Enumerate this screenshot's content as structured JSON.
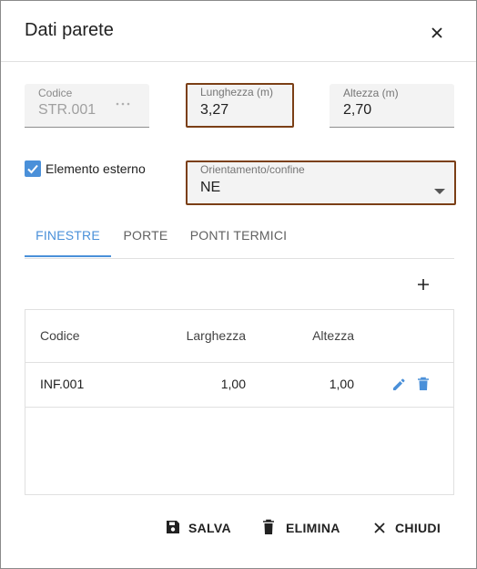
{
  "dialog": {
    "title": "Dati parete"
  },
  "fields": {
    "codice": {
      "label": "Codice",
      "value": "STR.001"
    },
    "lunghezza": {
      "label": "Lunghezza (m)",
      "value": "3,27"
    },
    "altezza": {
      "label": "Altezza (m)",
      "value": "2,70"
    },
    "elemento_esterno": {
      "label": "Elemento esterno",
      "checked": true
    },
    "orientamento": {
      "label": "Orientamento/confine",
      "value": "NE"
    }
  },
  "tabs": [
    {
      "label": "FINESTRE",
      "active": true
    },
    {
      "label": "PORTE",
      "active": false
    },
    {
      "label": "PONTI TERMICI",
      "active": false
    }
  ],
  "table": {
    "columns": [
      "Codice",
      "Larghezza",
      "Altezza"
    ],
    "rows": [
      {
        "codice": "INF.001",
        "larghezza": "1,00",
        "altezza": "1,00"
      }
    ]
  },
  "footer": {
    "save_label": "SALVA",
    "delete_label": "ELIMINA",
    "close_label": "CHIUDI"
  },
  "colors": {
    "accent": "#4a90d9",
    "focus_border": "#7b3f16"
  }
}
